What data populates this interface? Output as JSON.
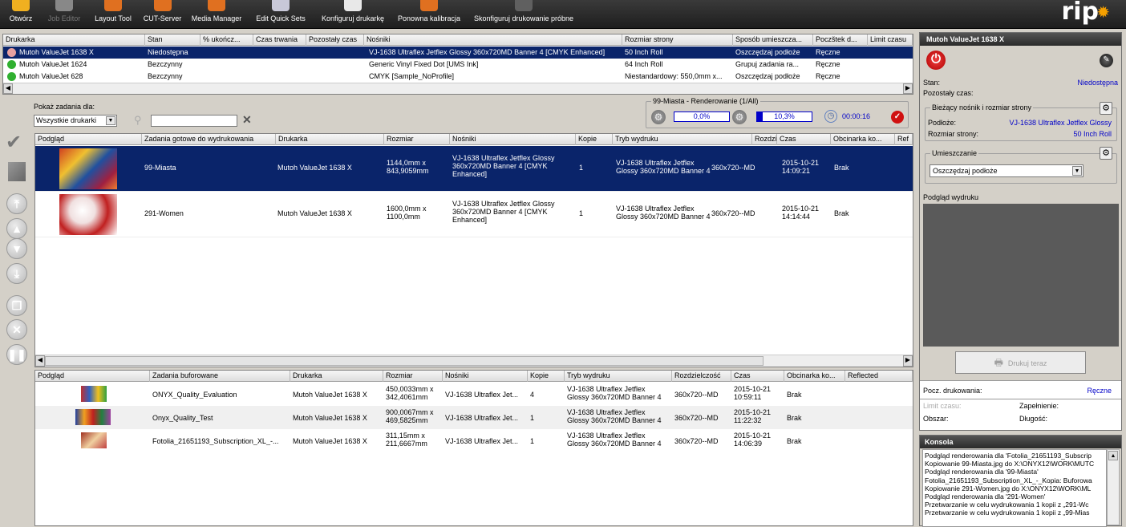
{
  "toolbar": {
    "items": [
      {
        "label": "Otwórz",
        "icon": "open-icon",
        "color": "#f0b020",
        "disabled": false
      },
      {
        "label": "Job Editor",
        "icon": "job-editor-icon",
        "color": "#888888",
        "disabled": true
      },
      {
        "label": "Layout Tool",
        "icon": "layout-tool-icon",
        "color": "#e07020",
        "disabled": false
      },
      {
        "label": "CUT-Server",
        "icon": "cut-server-icon",
        "color": "#e07020",
        "disabled": false
      },
      {
        "label": "Media Manager",
        "icon": "media-manager-icon",
        "color": "#e07020",
        "disabled": false
      },
      {
        "label": "Edit Quick Sets",
        "icon": "edit-quick-sets-icon",
        "color": "#c8c8d8",
        "disabled": false
      },
      {
        "label": "Konfiguruj drukarkę",
        "icon": "printer-config-icon",
        "color": "#e8e8e8",
        "disabled": false
      },
      {
        "label": "Ponowna kalibracja",
        "icon": "recalibrate-icon",
        "color": "#e07020",
        "disabled": false
      },
      {
        "label": "Skonfiguruj drukowanie próbne",
        "icon": "proof-print-icon",
        "color": "#606060",
        "disabled": false
      }
    ],
    "logo": "rip"
  },
  "printers": {
    "columns": [
      "Drukarka",
      "Stan",
      "% ukończ...",
      "Czas trwania",
      "Pozostały czas",
      "Nośniki",
      "Rozmiar strony",
      "Sposób umieszcza...",
      "Poczštek d...",
      "Limit czasu"
    ],
    "rows": [
      {
        "name": "Mutoh ValueJet 1638 X",
        "status": "Niedostępna",
        "media": "VJ-1638 Ultraflex Jetflex Glossy 360x720MD Banner 4 [CMYK Enhanced]",
        "size": "50 Inch Roll",
        "placement": "Oszczędzaj podłoże",
        "start": "Ręczne",
        "dot": "#e8a0a0",
        "selected": true
      },
      {
        "name": "Mutoh ValueJet 1624",
        "status": "Bezczynny",
        "media": "Generic Vinyl Fixed Dot [UMS Ink]",
        "size": "64 Inch Roll",
        "placement": "Grupuj zadania ra...",
        "start": "Ręczne",
        "dot": "#30b030",
        "selected": false
      },
      {
        "name": "Mutoh ValueJet 628",
        "status": "Bezczynny",
        "media": "CMYK [Sample_NoProfile]",
        "size": "Niestandardowy: 550,0mm x...",
        "placement": "Oszczędzaj podłoże",
        "start": "Ręczne",
        "dot": "#30b030",
        "selected": false
      }
    ]
  },
  "filter": {
    "label": "Pokaż zadania dla:",
    "select_value": "Wszystkie drukarki",
    "search_value": ""
  },
  "render": {
    "title": "99-Miasta - Renderowanie (1/All)",
    "progress1": "0,0%",
    "progress1_value": 0,
    "progress2": "10,3%",
    "progress2_value": 10.3,
    "time": "00:00:16"
  },
  "ready": {
    "columns": [
      "Podgląd",
      "Zadania gotowe do wydrukowania",
      "Drukarka",
      "Rozmiar",
      "Nośniki",
      "Kopie",
      "Tryb wydruku",
      "Rozdzielczość",
      "Czas",
      "Obcinarka ko...",
      "Ref"
    ],
    "rows": [
      {
        "name": "99-Miasta",
        "printer": "Mutoh ValueJet 1638 X",
        "size": "1144,0mm x\n843,9059mm",
        "media": "VJ-1638 Ultraflex Jetflex Glossy\n360x720MD Banner 4 [CMYK\nEnhanced]",
        "copies": "1",
        "mode": "VJ-1638 Ultraflex Jetflex\nGlossy 360x720MD Banner 4",
        "res": "360x720--MD",
        "time": "2015-10-21\n14:09:21",
        "cutter": "Brak",
        "selected": true
      },
      {
        "name": "291-Women",
        "printer": "Mutoh ValueJet 1638 X",
        "size": "1600,0mm x\n1100,0mm",
        "media": "VJ-1638 Ultraflex Jetflex Glossy\n360x720MD Banner 4 [CMYK\nEnhanced]",
        "copies": "1",
        "mode": "VJ-1638 Ultraflex Jetflex\nGlossy 360x720MD Banner 4",
        "res": "360x720--MD",
        "time": "2015-10-21\n14:14:44",
        "cutter": "Brak",
        "selected": false
      }
    ]
  },
  "buffered": {
    "columns": [
      "Podgląd",
      "Zadania buforowane",
      "Drukarka",
      "Rozmiar",
      "Nośniki",
      "Kopie",
      "Tryb wydruku",
      "Rozdzielczość",
      "Czas",
      "Obcinarka ko...",
      "Reflected"
    ],
    "rows": [
      {
        "name": "ONYX_Quality_Evaluation",
        "printer": "Mutoh ValueJet 1638 X",
        "size": "450,0033mm x\n342,4061mm",
        "media": "VJ-1638 Ultraflex Jet...",
        "copies": "4",
        "mode": "VJ-1638 Ultraflex Jetflex\nGlossy 360x720MD Banner 4",
        "res": "360x720--MD",
        "time": "2015-10-21\n10:59:11",
        "cutter": "Brak"
      },
      {
        "name": "Onyx_Quality_Test",
        "printer": "Mutoh ValueJet 1638 X",
        "size": "900,0067mm x\n469,5825mm",
        "media": "VJ-1638 Ultraflex Jet...",
        "copies": "1",
        "mode": "VJ-1638 Ultraflex Jetflex\nGlossy 360x720MD Banner 4",
        "res": "360x720--MD",
        "time": "2015-10-21\n11:22:32",
        "cutter": "Brak"
      },
      {
        "name": "Fotolia_21651193_Subscription_XL_-...",
        "printer": "Mutoh ValueJet 1638 X",
        "size": "311,15mm x\n211,6667mm",
        "media": "VJ-1638 Ultraflex Jet...",
        "copies": "1",
        "mode": "VJ-1638 Ultraflex Jetflex\nGlossy 360x720MD Banner 4",
        "res": "360x720--MD",
        "time": "2015-10-21\n14:06:39",
        "cutter": "Brak"
      }
    ]
  },
  "right": {
    "title": "Mutoh ValueJet 1638 X",
    "stan_label": "Stan:",
    "stan_value": "Niedostępna",
    "remaining_label": "Pozostały czas:",
    "media_group": "Bieżący nośnik i rozmiar strony",
    "substrate_label": "Podłoże:",
    "substrate_value": "VJ-1638 Ultraflex Jetflex Glossy",
    "pagesize_label": "Rozmiar strony:",
    "pagesize_value": "50 Inch Roll",
    "placement_group": "Umieszczanie",
    "placement_value": "Oszczędzaj podłoże",
    "preview_label": "Podgląd wydruku",
    "print_now": "Drukuj teraz",
    "start_label": "Pocz. drukowania:",
    "start_value": "Ręczne",
    "limit_label": "Limit czasu:",
    "fill_label": "Zapełnienie:",
    "area_label": "Obszar:",
    "length_label": "Długość:"
  },
  "console": {
    "title": "Konsola",
    "lines": [
      "Podgląd renderowania dla 'Fotolia_21651193_Subscrip",
      "Kopiowanie 99-Miasta.jpg do X:\\ONYX12\\WORK\\MUTC",
      "Podgląd renderowania dla '99-Miasta'",
      "Fotolia_21651193_Subscription_XL_-_Kopia: Buforowa",
      "Kopiowanie 291-Women.jpg do X:\\ONYX12\\WORK\\ML",
      "Podgląd renderowania dla '291-Women'",
      "Przetwarzanie w celu wydrukowania 1 kopii z „291-Wc",
      "Przetwarzanie w celu wydrukowania 1 kopii z „99-Mias"
    ]
  },
  "colors": {
    "selection": "#0a246a",
    "link": "#0000c8",
    "panel_header": "#3c3c3c"
  }
}
